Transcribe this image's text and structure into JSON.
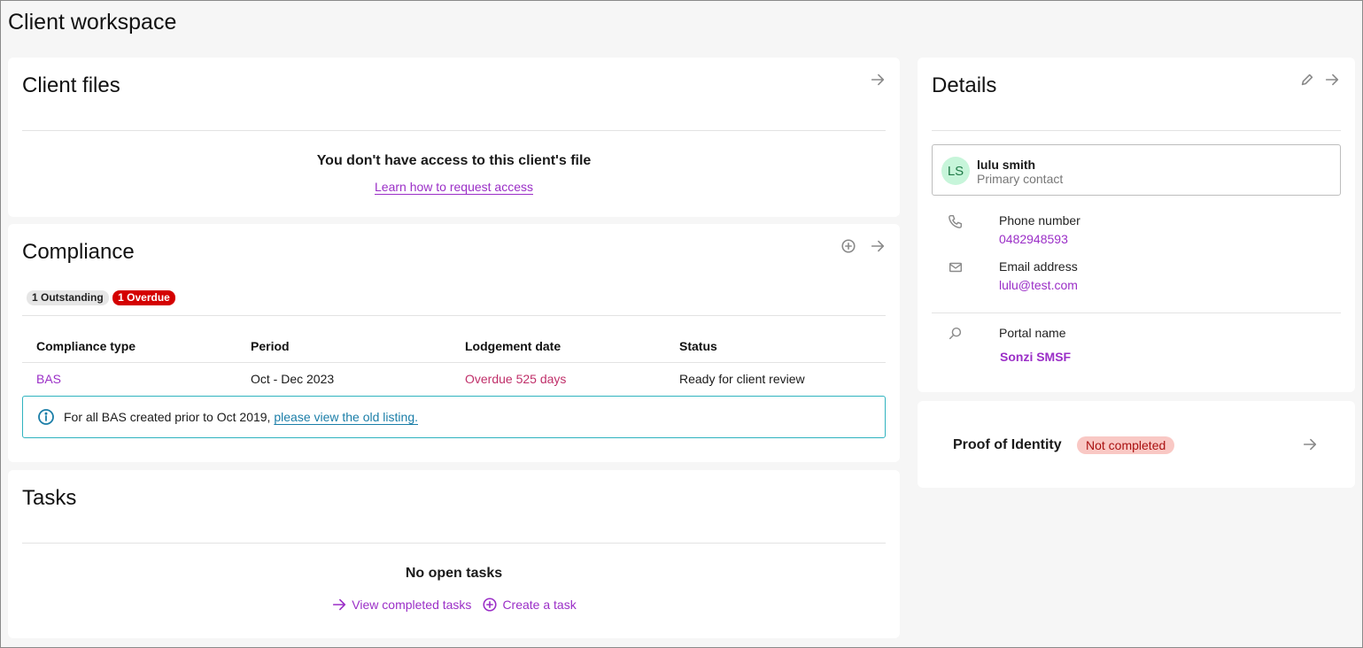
{
  "page_title": "Client workspace",
  "client_files": {
    "title": "Client files",
    "message": "You don't have access to this client's file",
    "link": "Learn how to request access"
  },
  "compliance": {
    "title": "Compliance",
    "badges": {
      "outstanding": "1 Outstanding",
      "overdue": "1 Overdue"
    },
    "headers": [
      "Compliance type",
      "Period",
      "Lodgement date",
      "Status"
    ],
    "rows": [
      {
        "type": "BAS",
        "period": "Oct - Dec 2023",
        "lodgement": "Overdue 525 days",
        "status": "Ready for client review"
      }
    ],
    "info_text": "For all BAS created prior to Oct 2019,",
    "info_link": "please view the old listing."
  },
  "tasks": {
    "title": "Tasks",
    "empty": "No open tasks",
    "view_completed": "View completed tasks",
    "create": "Create a task"
  },
  "details": {
    "title": "Details",
    "contact": {
      "initials": "LS",
      "name": "lulu smith",
      "role": "Primary contact"
    },
    "phone_label": "Phone number",
    "phone": "0482948593",
    "email_label": "Email address",
    "email": "lulu@test.com",
    "portal_label": "Portal name",
    "portal": "Sonzi SMSF"
  },
  "proof_of_identity": {
    "label": "Proof of Identity",
    "status": "Not completed"
  },
  "colors": {
    "accent": "#9b2fc7",
    "overdue_badge": "#d40000",
    "overdue_text": "#c0306a",
    "info_border": "#2fb3bf",
    "info_link": "#1b7ea8",
    "avatar_bg": "#c7f5da",
    "not_completed_bg": "#f9c8c4"
  }
}
